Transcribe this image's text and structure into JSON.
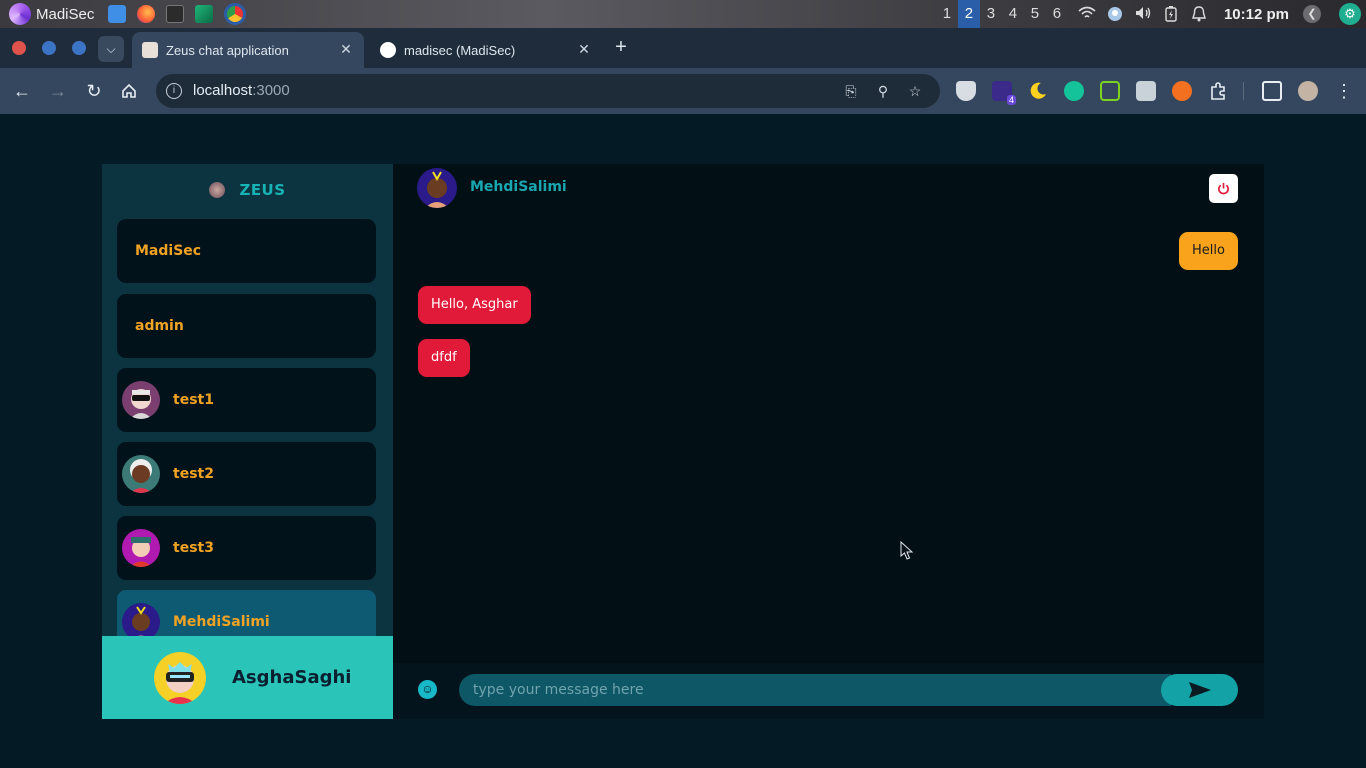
{
  "os": {
    "user": "MadiSec",
    "workspaces": [
      "1",
      "2",
      "3",
      "4",
      "5",
      "6"
    ],
    "active_workspace": "2",
    "time": "10:12 pm"
  },
  "browser": {
    "tabs": [
      {
        "title": "Zeus chat application",
        "active": true
      },
      {
        "title": "madisec (MadiSec)",
        "active": false
      }
    ],
    "url_host": "localhost",
    "url_port": ":3000",
    "extension_badge": "4"
  },
  "app": {
    "brand": "ZEUS",
    "contacts": [
      {
        "name": "MadiSec",
        "has_avatar": false
      },
      {
        "name": "admin",
        "has_avatar": false
      },
      {
        "name": "test1",
        "has_avatar": true
      },
      {
        "name": "test2",
        "has_avatar": true
      },
      {
        "name": "test3",
        "has_avatar": true
      },
      {
        "name": "MehdiSalimi",
        "has_avatar": true,
        "selected": true
      }
    ],
    "current_user": "AsghaSaghi",
    "chat": {
      "title": "MehdiSalimi",
      "messages": [
        {
          "text": "Hello",
          "direction": "outgoing"
        },
        {
          "text": "Hello, Asghar",
          "direction": "incoming"
        },
        {
          "text": "dfdf",
          "direction": "incoming"
        }
      ],
      "input_placeholder": "type your message here",
      "input_value": ""
    }
  },
  "colors": {
    "page_bg": "#041b26",
    "sidebar_bg": "#0b3340",
    "contact_bg": "#02121a",
    "contact_selected_bg": "#0e5a72",
    "contact_name": "#f0a223",
    "current_user_bg": "#2ac4b8",
    "chat_bg": "#020f15",
    "outgoing_bubble": "#f9a21c",
    "incoming_bubble": "#e21a3a",
    "accent": "#18b3b5"
  }
}
